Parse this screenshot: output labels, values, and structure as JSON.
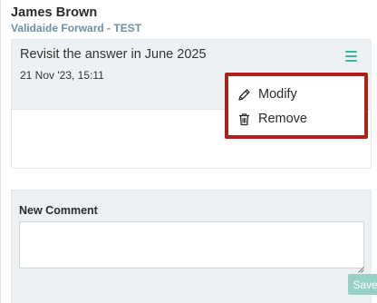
{
  "comment": {
    "author_name": "James Brown",
    "author_org": "Validaide Forward - TEST",
    "text": "Revisit the answer in June 2025",
    "date": "21 Nov '23, 15:11",
    "menu_icon": "hamburger-icon"
  },
  "context_menu": {
    "items": [
      {
        "label": "Modify",
        "icon": "pencil-icon"
      },
      {
        "label": "Remove",
        "icon": "trash-icon"
      }
    ],
    "highlight_color": "#a8231a"
  },
  "new_comment": {
    "label": "New Comment",
    "value": "",
    "save_label": "Save"
  },
  "colors": {
    "accent": "#3fb4a2",
    "save_button": "#96d0c6",
    "org_text": "#6f8fa3",
    "panel_bg": "#eef1f4"
  }
}
